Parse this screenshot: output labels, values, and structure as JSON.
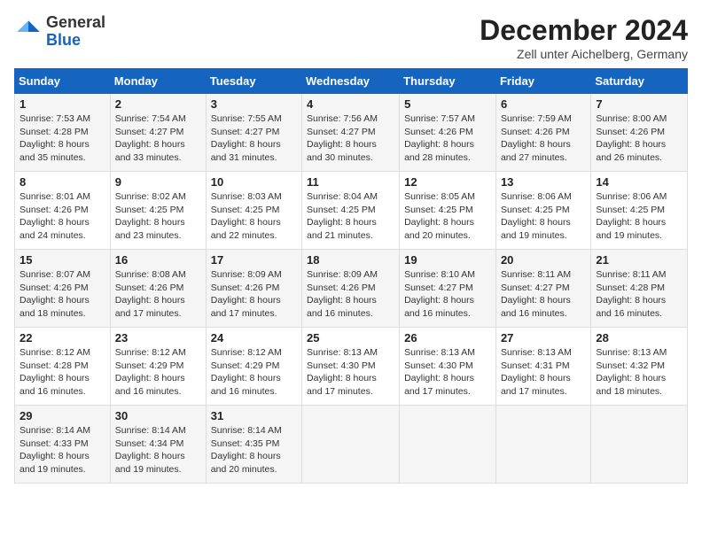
{
  "header": {
    "logo_general": "General",
    "logo_blue": "Blue",
    "month_title": "December 2024",
    "subtitle": "Zell unter Aichelberg, Germany"
  },
  "days_of_week": [
    "Sunday",
    "Monday",
    "Tuesday",
    "Wednesday",
    "Thursday",
    "Friday",
    "Saturday"
  ],
  "weeks": [
    [
      {
        "day": 1,
        "sunrise": "7:53 AM",
        "sunset": "4:28 PM",
        "daylight": "8 hours and 35 minutes."
      },
      {
        "day": 2,
        "sunrise": "7:54 AM",
        "sunset": "4:27 PM",
        "daylight": "8 hours and 33 minutes."
      },
      {
        "day": 3,
        "sunrise": "7:55 AM",
        "sunset": "4:27 PM",
        "daylight": "8 hours and 31 minutes."
      },
      {
        "day": 4,
        "sunrise": "7:56 AM",
        "sunset": "4:27 PM",
        "daylight": "8 hours and 30 minutes."
      },
      {
        "day": 5,
        "sunrise": "7:57 AM",
        "sunset": "4:26 PM",
        "daylight": "8 hours and 28 minutes."
      },
      {
        "day": 6,
        "sunrise": "7:59 AM",
        "sunset": "4:26 PM",
        "daylight": "8 hours and 27 minutes."
      },
      {
        "day": 7,
        "sunrise": "8:00 AM",
        "sunset": "4:26 PM",
        "daylight": "8 hours and 26 minutes."
      }
    ],
    [
      {
        "day": 8,
        "sunrise": "8:01 AM",
        "sunset": "4:26 PM",
        "daylight": "8 hours and 24 minutes."
      },
      {
        "day": 9,
        "sunrise": "8:02 AM",
        "sunset": "4:25 PM",
        "daylight": "8 hours and 23 minutes."
      },
      {
        "day": 10,
        "sunrise": "8:03 AM",
        "sunset": "4:25 PM",
        "daylight": "8 hours and 22 minutes."
      },
      {
        "day": 11,
        "sunrise": "8:04 AM",
        "sunset": "4:25 PM",
        "daylight": "8 hours and 21 minutes."
      },
      {
        "day": 12,
        "sunrise": "8:05 AM",
        "sunset": "4:25 PM",
        "daylight": "8 hours and 20 minutes."
      },
      {
        "day": 13,
        "sunrise": "8:06 AM",
        "sunset": "4:25 PM",
        "daylight": "8 hours and 19 minutes."
      },
      {
        "day": 14,
        "sunrise": "8:06 AM",
        "sunset": "4:25 PM",
        "daylight": "8 hours and 19 minutes."
      }
    ],
    [
      {
        "day": 15,
        "sunrise": "8:07 AM",
        "sunset": "4:26 PM",
        "daylight": "8 hours and 18 minutes."
      },
      {
        "day": 16,
        "sunrise": "8:08 AM",
        "sunset": "4:26 PM",
        "daylight": "8 hours and 17 minutes."
      },
      {
        "day": 17,
        "sunrise": "8:09 AM",
        "sunset": "4:26 PM",
        "daylight": "8 hours and 17 minutes."
      },
      {
        "day": 18,
        "sunrise": "8:09 AM",
        "sunset": "4:26 PM",
        "daylight": "8 hours and 16 minutes."
      },
      {
        "day": 19,
        "sunrise": "8:10 AM",
        "sunset": "4:27 PM",
        "daylight": "8 hours and 16 minutes."
      },
      {
        "day": 20,
        "sunrise": "8:11 AM",
        "sunset": "4:27 PM",
        "daylight": "8 hours and 16 minutes."
      },
      {
        "day": 21,
        "sunrise": "8:11 AM",
        "sunset": "4:28 PM",
        "daylight": "8 hours and 16 minutes."
      }
    ],
    [
      {
        "day": 22,
        "sunrise": "8:12 AM",
        "sunset": "4:28 PM",
        "daylight": "8 hours and 16 minutes."
      },
      {
        "day": 23,
        "sunrise": "8:12 AM",
        "sunset": "4:29 PM",
        "daylight": "8 hours and 16 minutes."
      },
      {
        "day": 24,
        "sunrise": "8:12 AM",
        "sunset": "4:29 PM",
        "daylight": "8 hours and 16 minutes."
      },
      {
        "day": 25,
        "sunrise": "8:13 AM",
        "sunset": "4:30 PM",
        "daylight": "8 hours and 17 minutes."
      },
      {
        "day": 26,
        "sunrise": "8:13 AM",
        "sunset": "4:30 PM",
        "daylight": "8 hours and 17 minutes."
      },
      {
        "day": 27,
        "sunrise": "8:13 AM",
        "sunset": "4:31 PM",
        "daylight": "8 hours and 17 minutes."
      },
      {
        "day": 28,
        "sunrise": "8:13 AM",
        "sunset": "4:32 PM",
        "daylight": "8 hours and 18 minutes."
      }
    ],
    [
      {
        "day": 29,
        "sunrise": "8:14 AM",
        "sunset": "4:33 PM",
        "daylight": "8 hours and 19 minutes."
      },
      {
        "day": 30,
        "sunrise": "8:14 AM",
        "sunset": "4:34 PM",
        "daylight": "8 hours and 19 minutes."
      },
      {
        "day": 31,
        "sunrise": "8:14 AM",
        "sunset": "4:35 PM",
        "daylight": "8 hours and 20 minutes."
      },
      null,
      null,
      null,
      null
    ]
  ],
  "labels": {
    "sunrise": "Sunrise:",
    "sunset": "Sunset:",
    "daylight": "Daylight:"
  }
}
